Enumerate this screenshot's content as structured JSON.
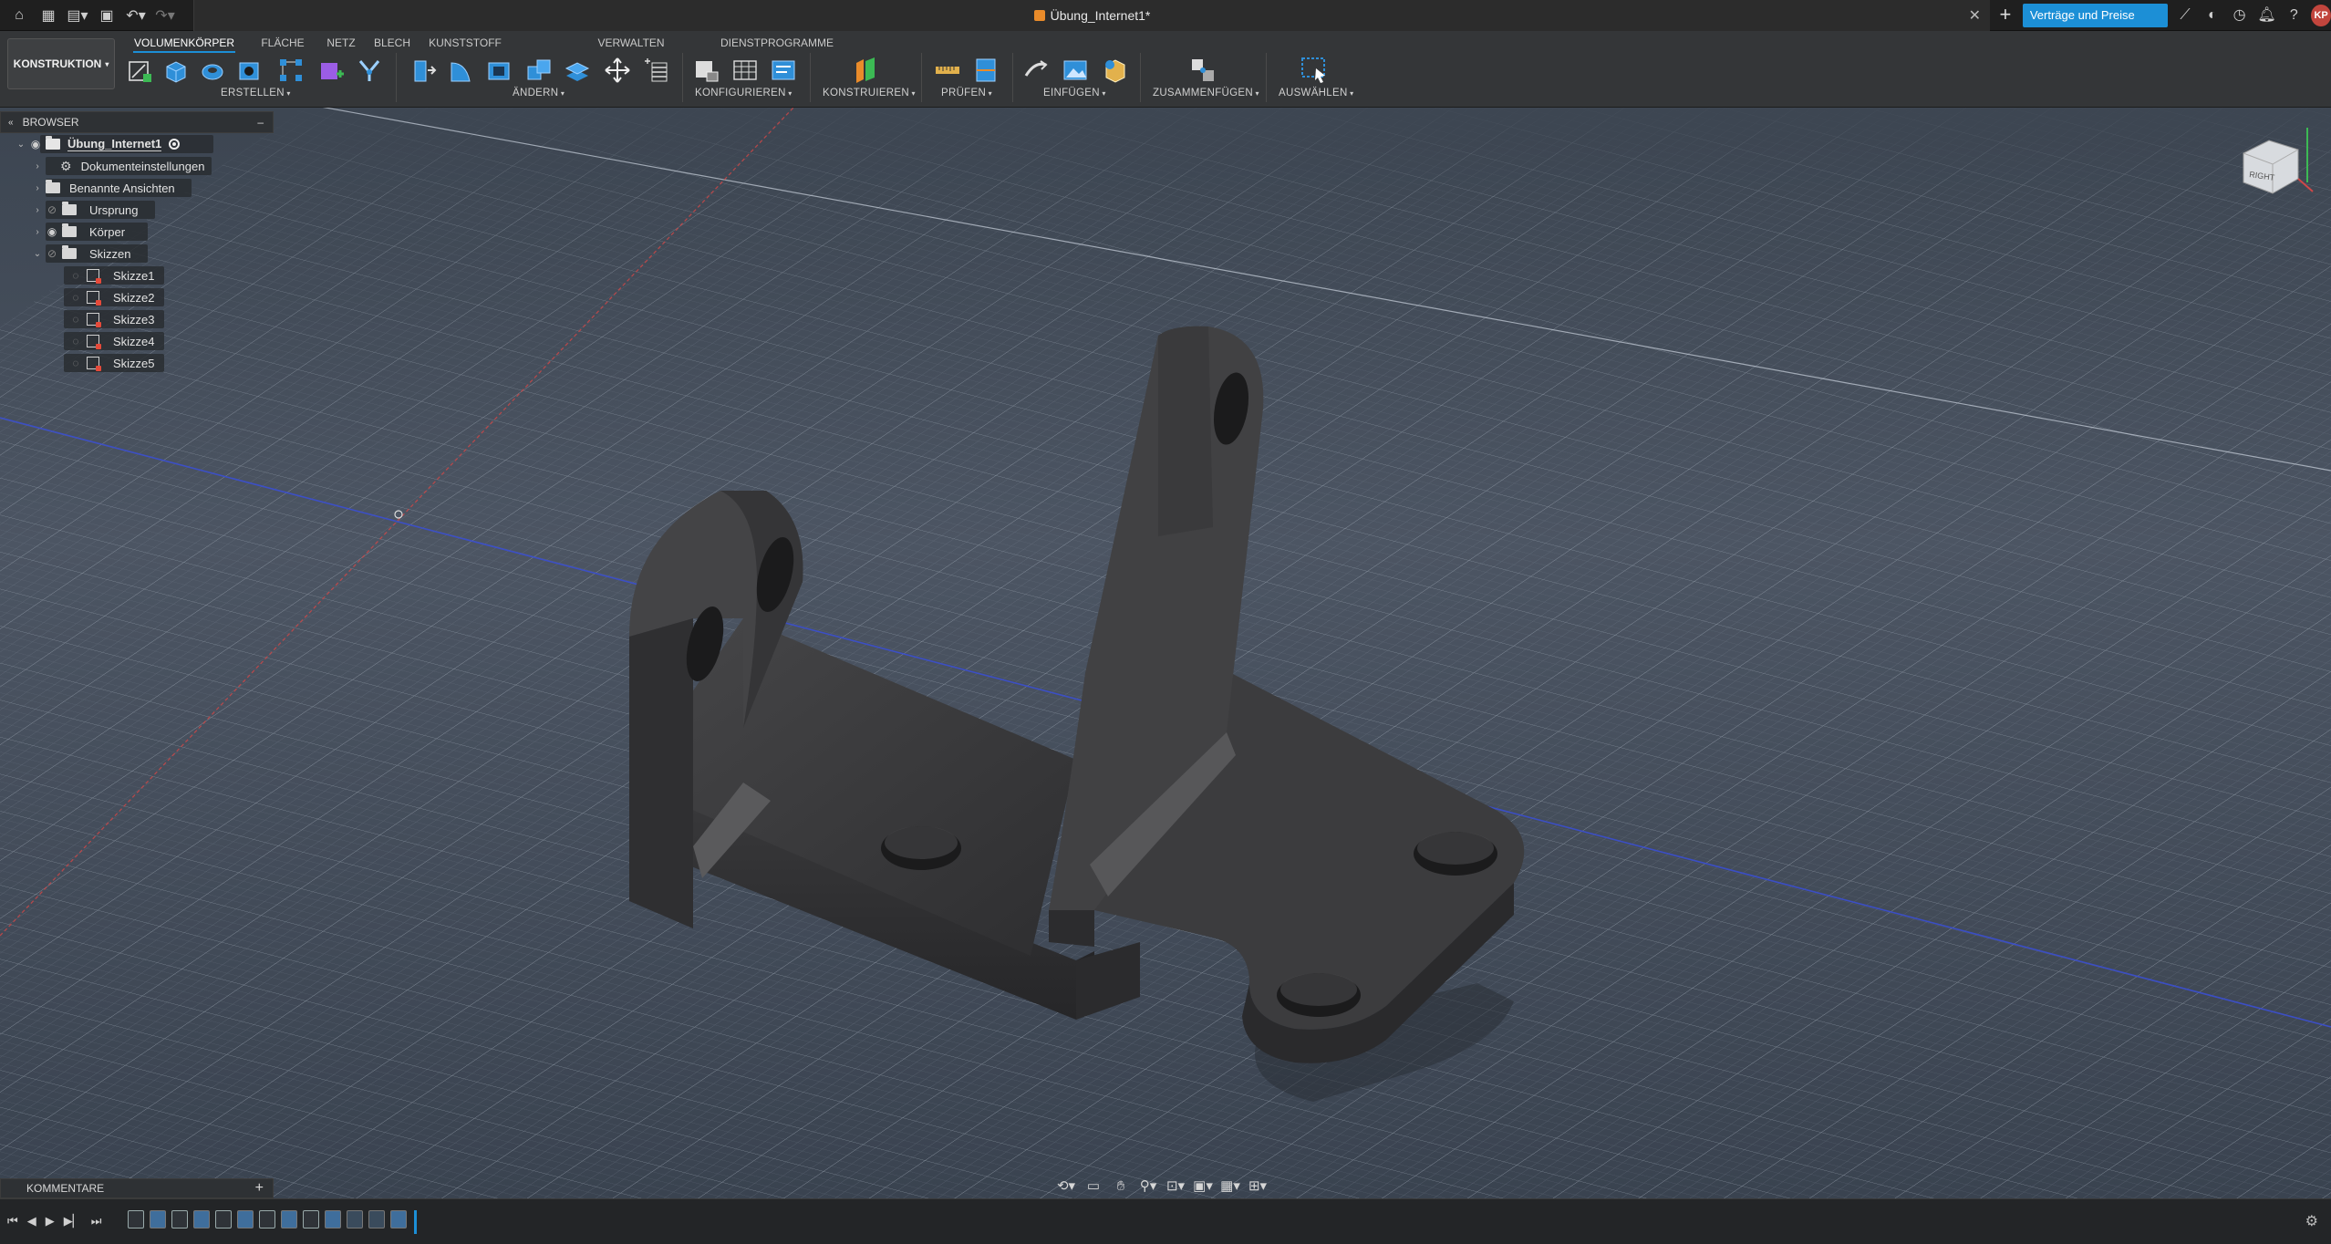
{
  "window": {
    "document_title": "Übung_Internet1*",
    "promo_button": "Verträge und Preise anze...",
    "user_initials": "KP"
  },
  "ribbon": {
    "workspace": "KONSTRUKTION",
    "tabs": [
      "VOLUMENKÖRPER",
      "FLÄCHE",
      "NETZ",
      "BLECH",
      "KUNSTSTOFF",
      "VERWALTEN",
      "DIENSTPROGRAMME"
    ],
    "active_tab": "VOLUMENKÖRPER",
    "groups": {
      "erstellen": "ERSTELLEN",
      "aendern": "ÄNDERN",
      "konfigurieren": "KONFIGURIEREN",
      "konstruieren": "KONSTRUIEREN",
      "pruefen": "PRÜFEN",
      "einfuegen": "EINFÜGEN",
      "zusammenfuegen": "ZUSAMMENFÜGEN",
      "auswaehlen": "AUSWÄHLEN"
    }
  },
  "browser": {
    "title": "BROWSER",
    "root": "Übung_Internet1",
    "items": [
      {
        "label": "Dokumenteinstellungen"
      },
      {
        "label": "Benannte Ansichten"
      },
      {
        "label": "Ursprung"
      },
      {
        "label": "Körper"
      },
      {
        "label": "Skizzen"
      }
    ],
    "sketches": [
      "Skizze1",
      "Skizze2",
      "Skizze3",
      "Skizze4",
      "Skizze5"
    ]
  },
  "viewcube": {
    "face": "RIGHT"
  },
  "comments": {
    "title": "KOMMENTARE"
  },
  "colors": {
    "accent": "#1c8fd6",
    "part": "#3b3b3d",
    "grid_bg": "#46505d"
  }
}
